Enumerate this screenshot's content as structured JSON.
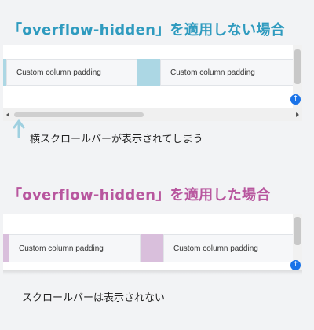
{
  "without_hidden": {
    "title": "「overflow-hidden」を適用しない場合",
    "columns": [
      "Custom column padding",
      "Custom column padding"
    ],
    "caption": "横スクロールバーが表示されてしまう"
  },
  "with_hidden": {
    "title": "「overflow-hidden」を適用した場合",
    "columns": [
      "Custom column padding",
      "Custom column padding"
    ],
    "caption": "スクロールバーは表示されない"
  },
  "colors": {
    "title_blue": "#2f9bbf",
    "title_purple": "#b8569e",
    "gutter_blue": "#acd7e4",
    "gutter_purple": "#d9bfdc",
    "fab_blue": "#1a73e8"
  },
  "icons": {
    "fab": "arrow-up-circle-icon",
    "pointer": "arrow-up-icon"
  }
}
